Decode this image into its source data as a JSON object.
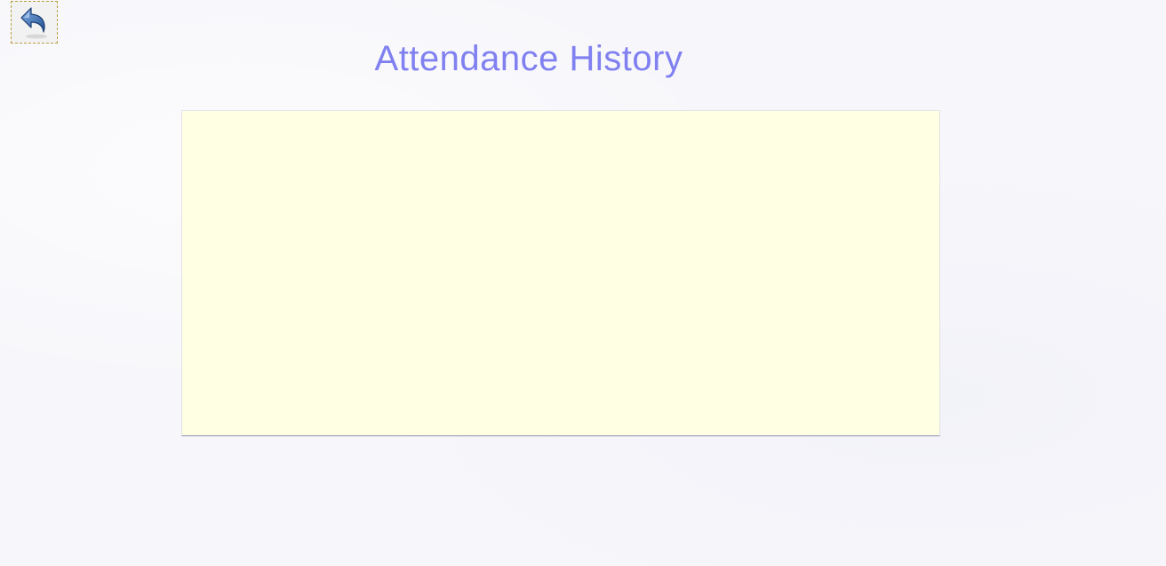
{
  "header": {
    "title": "Attendance History",
    "back_button": {
      "icon": "undo-arrow-icon"
    }
  },
  "history_panel": {
    "rows": []
  },
  "colors": {
    "title": "#8080f0",
    "panel_background": "#ffffe3",
    "page_background": "#f7f7fb",
    "icon_blue": "#3b6fb0"
  }
}
